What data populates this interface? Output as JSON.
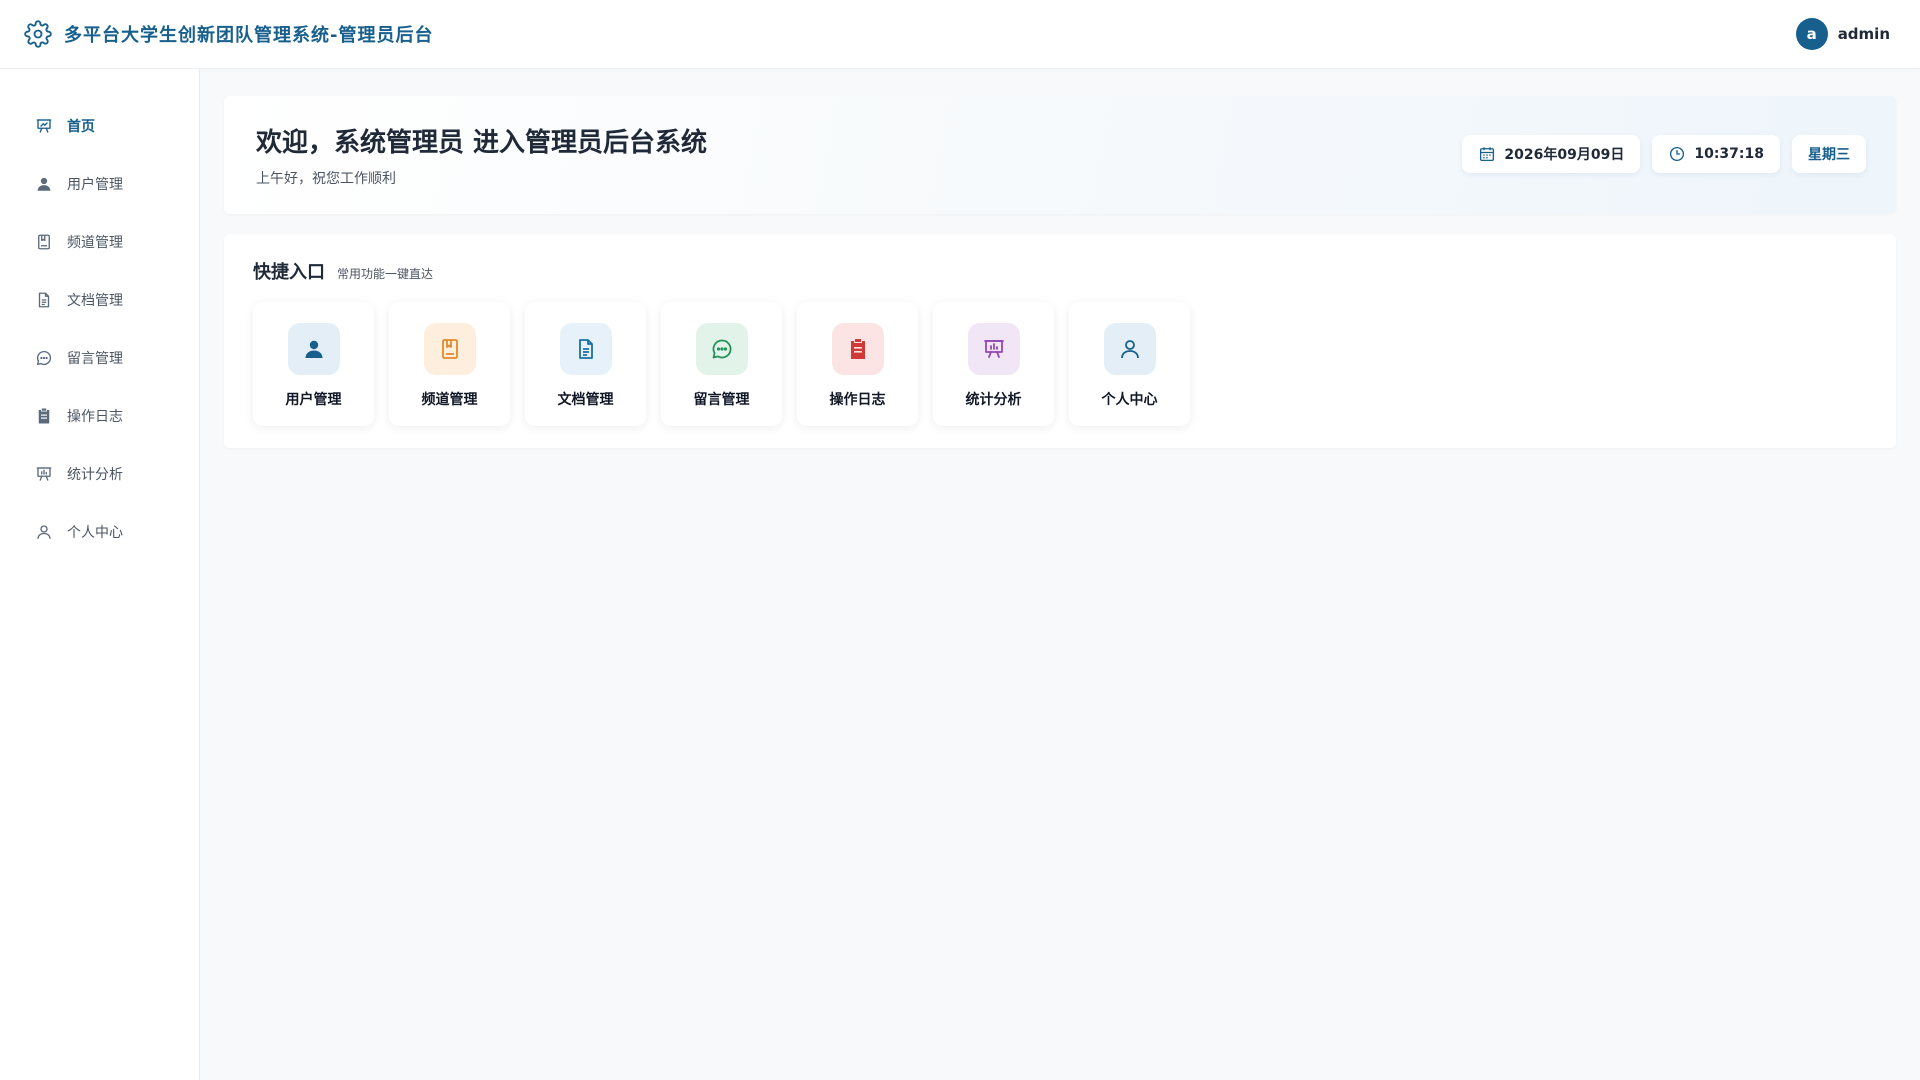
{
  "header": {
    "title": "多平台大学生创新团队管理系统-管理员后台",
    "avatar_letter": "a",
    "username": "admin"
  },
  "sidebar": {
    "items": [
      {
        "label": "首页",
        "icon": "presentation-chart-icon",
        "active": true
      },
      {
        "label": "用户管理",
        "icon": "user-icon",
        "active": false
      },
      {
        "label": "频道管理",
        "icon": "bookmark-book-icon",
        "active": false
      },
      {
        "label": "文档管理",
        "icon": "document-icon",
        "active": false
      },
      {
        "label": "留言管理",
        "icon": "chat-bubble-icon",
        "active": false
      },
      {
        "label": "操作日志",
        "icon": "clipboard-icon",
        "active": false
      },
      {
        "label": "统计分析",
        "icon": "presentation-chart-icon",
        "active": false
      },
      {
        "label": "个人中心",
        "icon": "user-outline-icon",
        "active": false
      }
    ]
  },
  "welcome": {
    "title": "欢迎，系统管理员 进入管理员后台系统",
    "subtitle": "上午好，祝您工作顺利",
    "date": "2026年09月09日",
    "time": "10:37:18",
    "weekday": "星期三"
  },
  "quick": {
    "title": "快捷入口",
    "subtitle": "常用功能一键直达",
    "cards": [
      {
        "label": "用户管理",
        "icon": "user-icon",
        "bg": "#e3eef7",
        "fg": "#175f8d"
      },
      {
        "label": "频道管理",
        "icon": "bookmark-book-icon",
        "bg": "#fdeede",
        "fg": "#e08a2c"
      },
      {
        "label": "文档管理",
        "icon": "document-icon",
        "bg": "#e6f1f9",
        "fg": "#1b6ea6"
      },
      {
        "label": "留言管理",
        "icon": "chat-bubble-icon",
        "bg": "#e2f4ea",
        "fg": "#27915a"
      },
      {
        "label": "操作日志",
        "icon": "clipboard-icon",
        "bg": "#fde4e4",
        "fg": "#d03a36"
      },
      {
        "label": "统计分析",
        "icon": "presentation-chart-icon",
        "bg": "#f1e6f5",
        "fg": "#9447b3"
      },
      {
        "label": "个人中心",
        "icon": "user-outline-icon",
        "bg": "#e3eef7",
        "fg": "#175f8d"
      }
    ]
  },
  "colors": {
    "primary": "#175f8d",
    "page_bg": "#f7f9fb"
  }
}
